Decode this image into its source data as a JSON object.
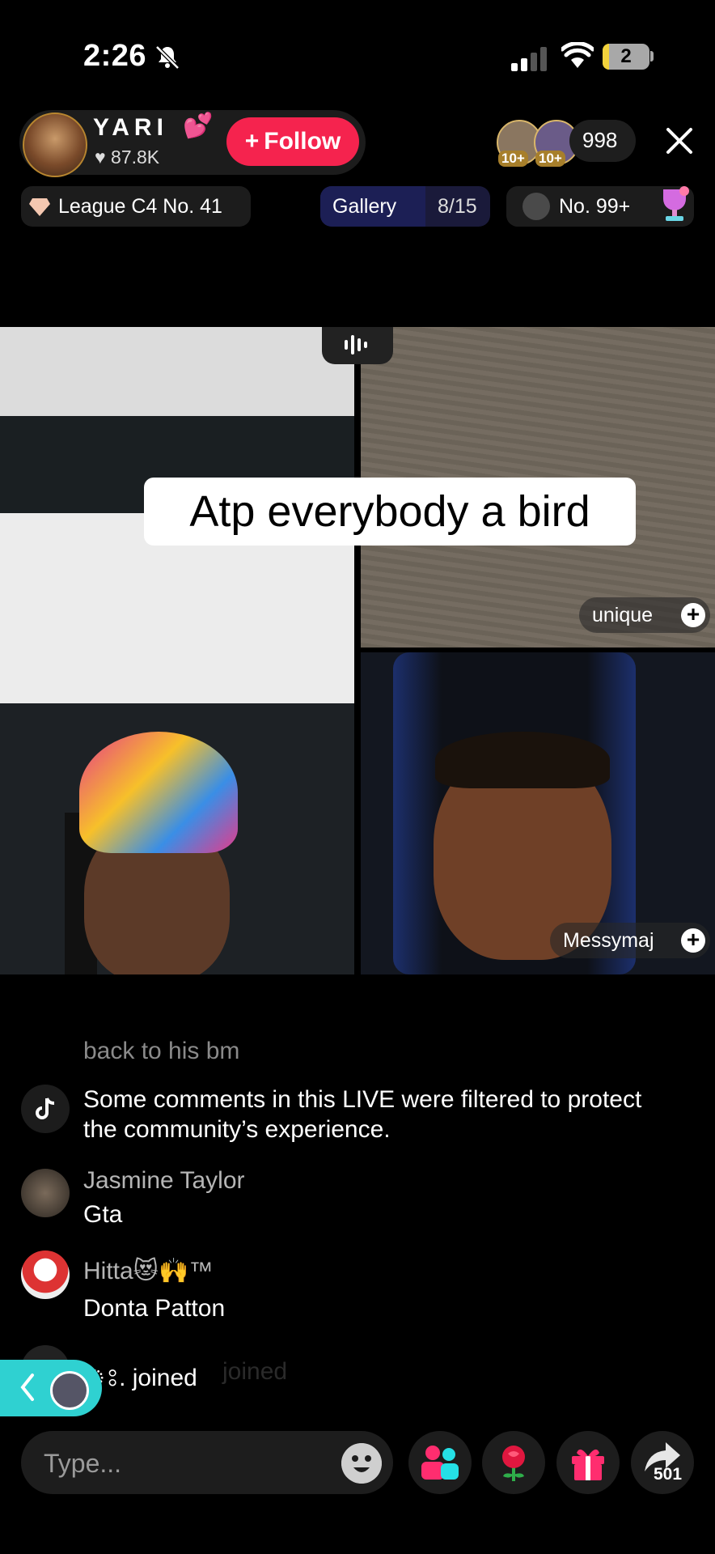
{
  "status": {
    "time": "2:26",
    "battery": "2"
  },
  "host": {
    "name": "YARI",
    "emoji": "💕",
    "likes": "87.8K",
    "follow_label": "Follow"
  },
  "viewers": {
    "badge1": "10+",
    "badge2": "10+",
    "count": "998"
  },
  "info_row": {
    "league": "League C4 No. 41",
    "gallery_label": "Gallery",
    "gallery_count": "8/15",
    "rank": "No. 99+"
  },
  "video": {
    "caption": "Atp everybody a bird",
    "tags": [
      "unique",
      "Messymaj"
    ]
  },
  "comments": {
    "fading": "back to his bm",
    "system_notice": "Some comments in this LIVE were filtered to protect the community’s experience.",
    "items": [
      {
        "user": "Jasmine Taylor",
        "text": "Gta"
      },
      {
        "user": "Hitta😻🙌™",
        "text": "Donta Patton"
      }
    ],
    "joined_text": "joined",
    "joined_prefix": "ঃ.",
    "joined_ghost": "joined"
  },
  "bottom": {
    "input_placeholder": "Type...",
    "share_count": "501"
  },
  "colors": {
    "follow": "#f5234e",
    "side_tab": "#2fd1d1",
    "background": "#000000"
  }
}
